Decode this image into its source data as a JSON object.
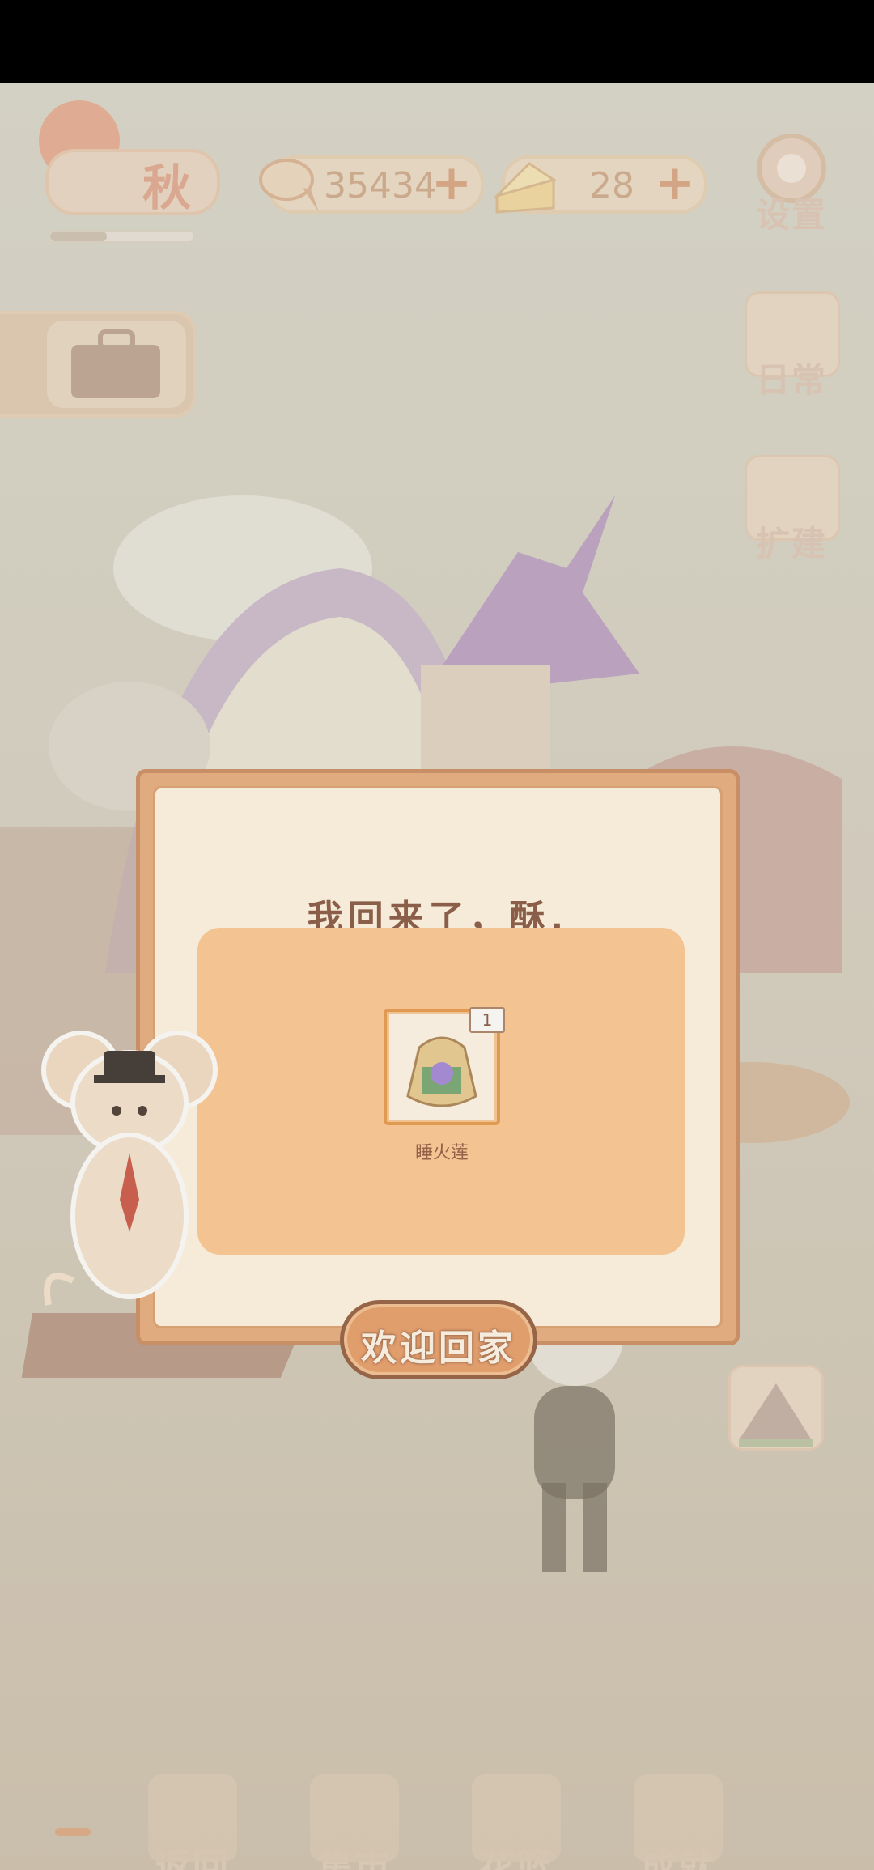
{
  "hud": {
    "season": "秋",
    "fish_count": "35434",
    "cheese_count": "28",
    "plus": "+"
  },
  "side_buttons": {
    "settings": "设置",
    "daily": "日常",
    "expand": "扩建"
  },
  "dialog": {
    "title": "我回来了，酥.",
    "reward": {
      "count": "1",
      "name": "睡火莲"
    },
    "confirm_button": "欢迎回家"
  },
  "bottom_nav": {
    "items": [
      {
        "label": "返回"
      },
      {
        "label": "集市"
      },
      {
        "label": "花篮"
      },
      {
        "label": "成就"
      }
    ]
  },
  "colors": {
    "dialog_border": "#e6a874",
    "dialog_bg": "#fff6e2",
    "reward_panel": "#fec58d",
    "title_text": "#7e4a34"
  }
}
